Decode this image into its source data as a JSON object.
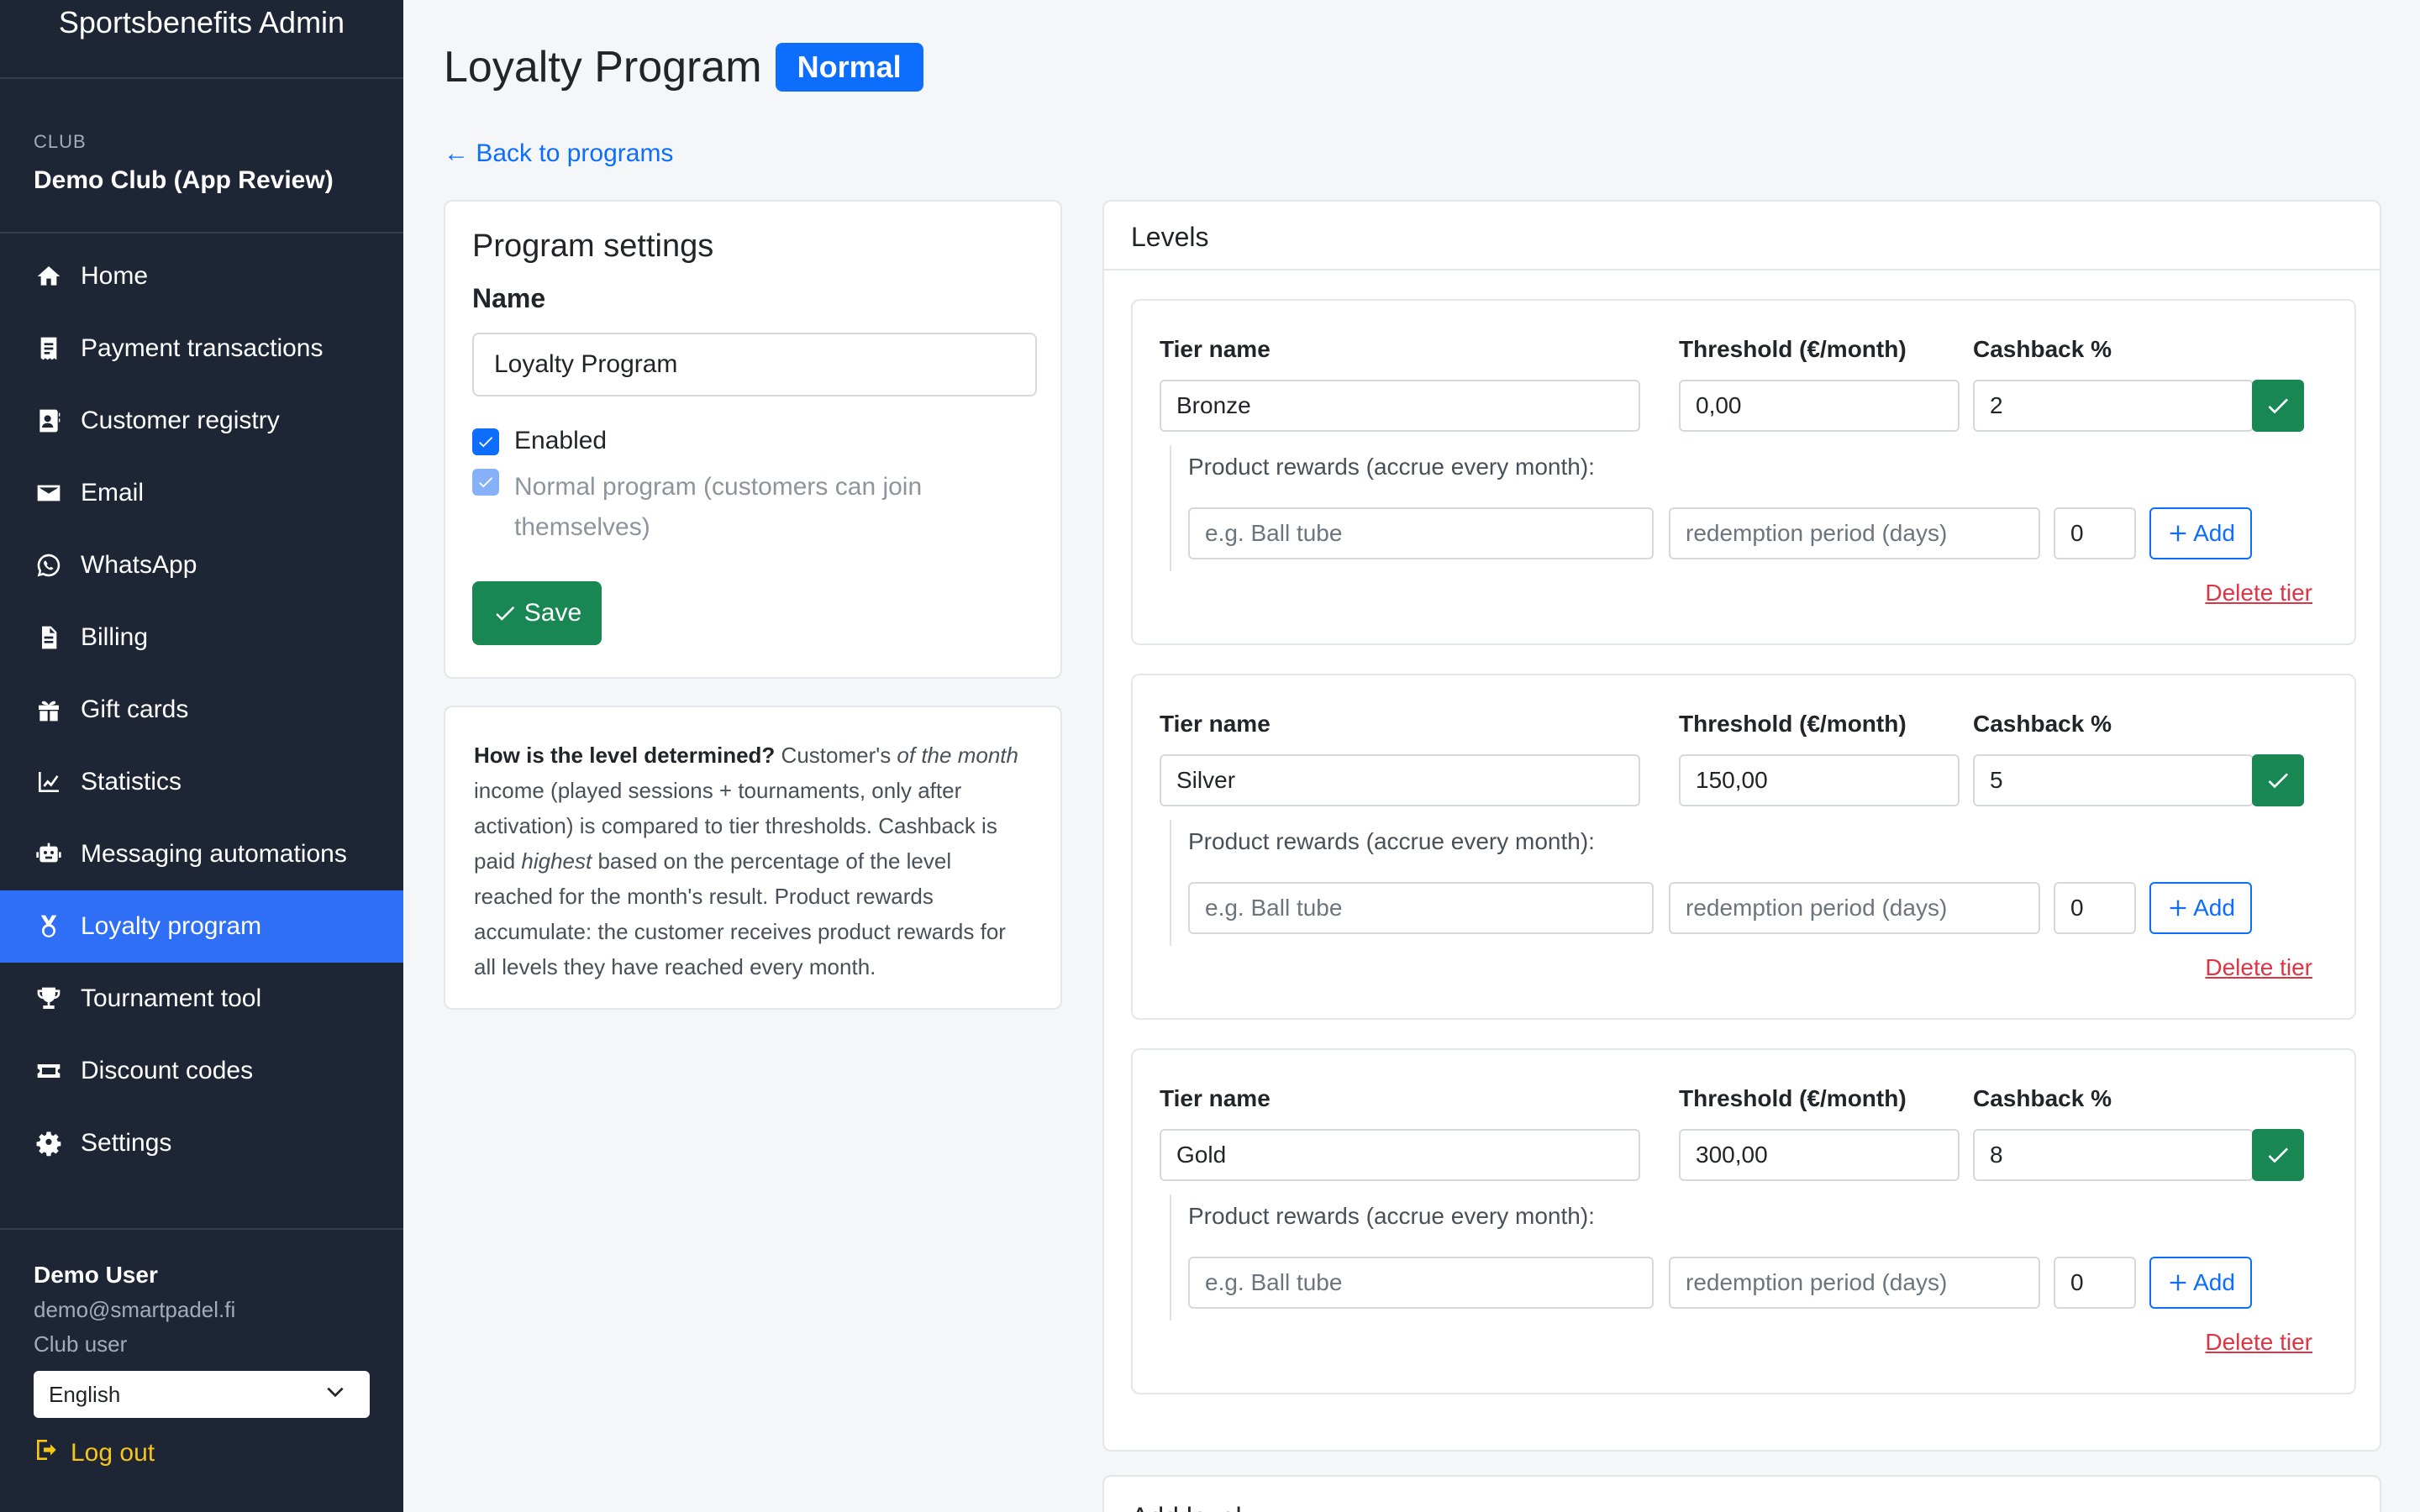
{
  "app": {
    "title": "Sportsbenefits Admin"
  },
  "club": {
    "label": "CLUB",
    "name": "Demo Club (App Review)"
  },
  "nav": [
    {
      "label": "Home",
      "icon": "home-icon"
    },
    {
      "label": "Payment transactions",
      "icon": "receipt-icon"
    },
    {
      "label": "Customer registry",
      "icon": "contact-book-icon"
    },
    {
      "label": "Email",
      "icon": "envelope-icon"
    },
    {
      "label": "WhatsApp",
      "icon": "whatsapp-icon"
    },
    {
      "label": "Billing",
      "icon": "document-icon"
    },
    {
      "label": "Gift cards",
      "icon": "gift-icon"
    },
    {
      "label": "Statistics",
      "icon": "line-chart-icon"
    },
    {
      "label": "Messaging automations",
      "icon": "robot-icon"
    },
    {
      "label": "Loyalty program",
      "icon": "medal-icon",
      "active": true
    },
    {
      "label": "Tournament tool",
      "icon": "trophy-icon"
    },
    {
      "label": "Discount codes",
      "icon": "ticket-icon"
    },
    {
      "label": "Settings",
      "icon": "gear-icon"
    }
  ],
  "user": {
    "name": "Demo User",
    "email": "demo@smartpadel.fi",
    "role": "Club user",
    "language": "English",
    "logout_label": "Log out"
  },
  "page": {
    "title": "Loyalty Program",
    "badge": "Normal",
    "back_link": "← Back to programs"
  },
  "settings": {
    "heading": "Program settings",
    "name_label": "Name",
    "name_value": "Loyalty Program",
    "enabled_label": "Enabled",
    "normal_label": "Normal program (customers can join themselves)",
    "save_label": "Save"
  },
  "info": {
    "q": "How is the level determined?",
    "t1": " Customer's ",
    "e1": "of the month",
    "t2": " income (played sessions + tournaments, only after activation) is compared to tier thresholds. Cashback is paid ",
    "e2": "highest",
    "t3": " based on the percentage of the level reached for the month's result. Product rewards accumulate: the customer receives product rewards for all levels they have reached every month."
  },
  "levels": {
    "heading": "Levels",
    "labels": {
      "tier_name": "Tier name",
      "threshold": "Threshold (€/month)",
      "cashback": "Cashback %",
      "rewards": "Product rewards (accrue every month):",
      "product_placeholder": "e.g. Ball tube",
      "period_placeholder": "redemption period (days)",
      "add": "Add",
      "delete": "Delete tier"
    },
    "tiers": [
      {
        "name": "Bronze",
        "threshold": "0,00",
        "cashback": "2",
        "qty": "0"
      },
      {
        "name": "Silver",
        "threshold": "150,00",
        "cashback": "5",
        "qty": "0"
      },
      {
        "name": "Gold",
        "threshold": "300,00",
        "cashback": "8",
        "qty": "0"
      }
    ]
  },
  "next_card": {
    "heading": "Add level"
  },
  "colors": {
    "sidebar": "#1e2535",
    "accent": "#2f6ff5",
    "success": "#198754",
    "danger": "#dc3545",
    "link": "#0d6efd"
  }
}
